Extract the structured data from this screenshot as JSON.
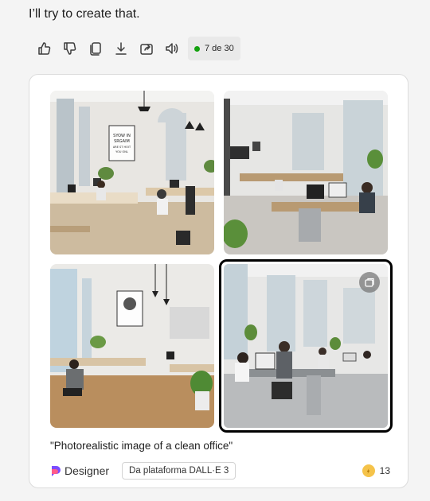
{
  "message": {
    "text": "I’ll try to create that."
  },
  "actions": {
    "counter_text": "7 de 30"
  },
  "card": {
    "caption": "\"Photorealistic image of a clean office\"",
    "brand": "Designer",
    "platform_label": "Da plataforma DALL·E 3",
    "boost_count": "13",
    "poster_text": "SYOW IN SRGAIM ARE ST HOIT YOU ONL"
  },
  "colors": {
    "accent_dot": "#13a10e",
    "selected_border": "#000000",
    "coin": "#f5c34a"
  }
}
